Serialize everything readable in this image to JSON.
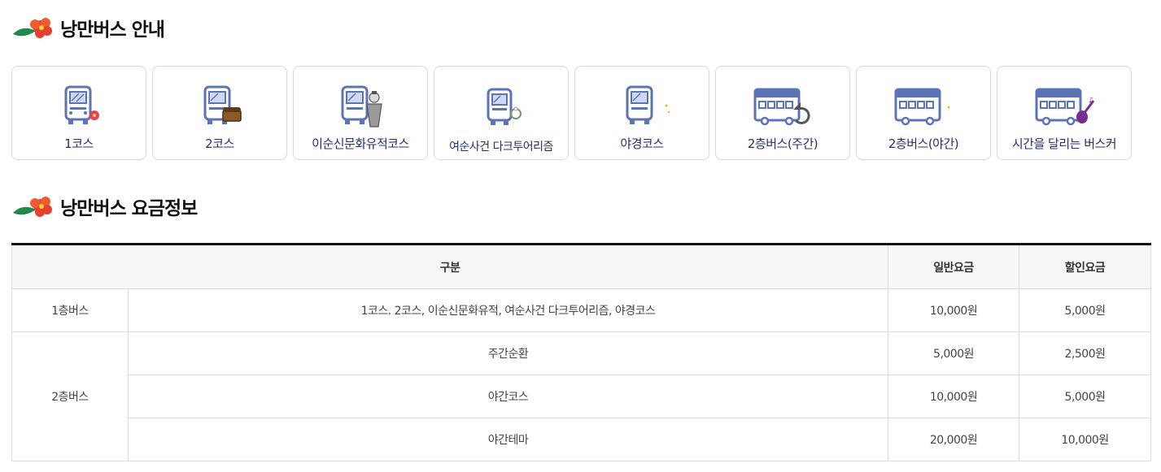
{
  "sections": {
    "guide_title": "낭만버스 안내",
    "fee_title": "낭만버스 요금정보"
  },
  "courses": [
    {
      "label": "1코스",
      "icon": "bus-flower-icon"
    },
    {
      "label": "2코스",
      "icon": "bus-treasure-chest-icon"
    },
    {
      "label": "이순신문화유적코스",
      "icon": "bus-admiral-icon"
    },
    {
      "label": "여순사건 다크투어리즘",
      "icon": "bus-flower-wreath-icon"
    },
    {
      "label": "야경코스",
      "icon": "bus-moon-icon"
    },
    {
      "label": "2층버스(주간)",
      "icon": "double-decker-refresh-icon"
    },
    {
      "label": "2층버스(야간)",
      "icon": "double-decker-moon-icon"
    },
    {
      "label": "시간을 달리는 버스커",
      "icon": "double-decker-guitar-icon"
    }
  ],
  "fee_table": {
    "headers": {
      "category": "구분",
      "regular": "일반요금",
      "discount": "할인요금"
    },
    "rows": [
      {
        "type": "1층버스",
        "course": "1코스. 2코스, 이순신문화유적, 여순사건 다크투어리즘, 야경코스",
        "regular": "10,000원",
        "discount": "5,000원"
      },
      {
        "type": "2층버스",
        "course": "주간순환",
        "regular": "5,000원",
        "discount": "2,500원"
      },
      {
        "type": "",
        "course": "야간코스",
        "regular": "10,000원",
        "discount": "5,000원"
      },
      {
        "type": "",
        "course": "야간테마",
        "regular": "20,000원",
        "discount": "10,000원"
      }
    ]
  },
  "colors": {
    "accent_navy": "#25306c",
    "bus_blue": "#5b74b5",
    "flower_red": "#e8402e",
    "leaf_green": "#1f8a4c"
  }
}
